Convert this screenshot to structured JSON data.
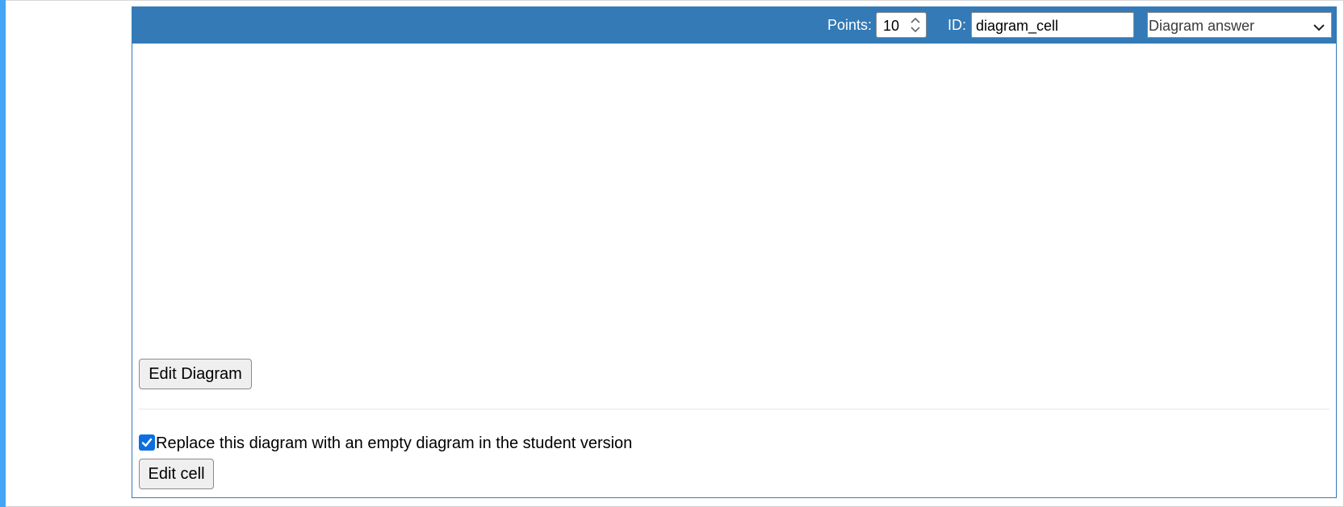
{
  "header": {
    "points_label": "Points:",
    "points_value": "10",
    "id_label": "ID:",
    "id_value": "diagram_cell",
    "cell_type_selected": "Diagram answer"
  },
  "body": {
    "edit_diagram_label": "Edit Diagram",
    "replace_checkbox_label": "Replace this diagram with an empty diagram in the student version",
    "replace_checkbox_checked": true,
    "edit_cell_label": "Edit cell"
  },
  "colors": {
    "header_background": "#337ab7",
    "left_accent": "#42a5f5",
    "checkbox": "#0b6fe0"
  },
  "icons": {
    "spinner": "spin-up-down-icon",
    "select_caret": "chevron-down-icon",
    "checkbox_mark": "checkmark-icon"
  }
}
